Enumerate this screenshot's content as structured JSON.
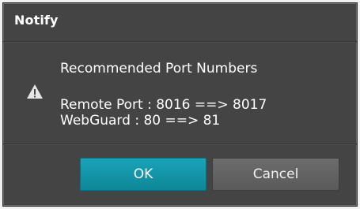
{
  "dialog": {
    "title": "Notify",
    "icon": "warning-icon",
    "heading": "Recommended Port Numbers",
    "lines": [
      "Remote Port : 8016 ==> 8017",
      "WebGuard : 80 ==> 81"
    ],
    "buttons": {
      "ok_label": "OK",
      "cancel_label": "Cancel"
    }
  },
  "colors": {
    "dialog_bg": "#444444",
    "ok_button": "#1296aa",
    "cancel_button": "#626262",
    "text": "#ffffff"
  }
}
